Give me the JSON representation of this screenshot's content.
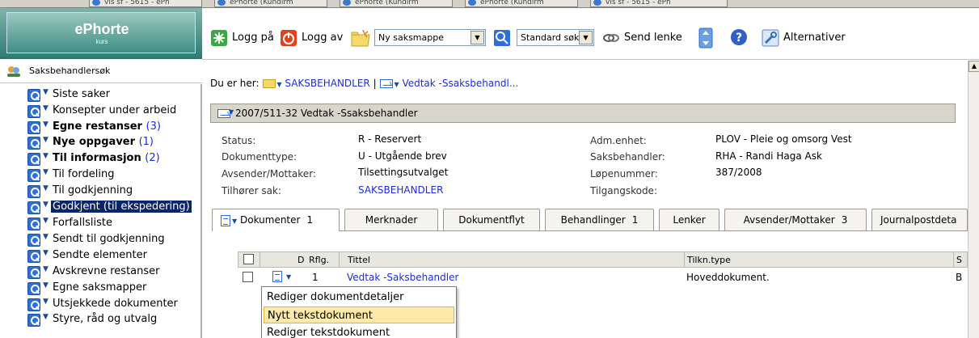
{
  "browser_tabs": [
    {
      "label": "vis sf - 5615 - ePh"
    },
    {
      "label": "ePhorte (Kundirm"
    },
    {
      "label": "ePhorte (Kundirm"
    },
    {
      "label": "ePhorte (Kundirm"
    },
    {
      "label": "vis sf - 5615 - ePh"
    }
  ],
  "logo": {
    "brand": "ePhorte",
    "sub": "kurs"
  },
  "sidebar": {
    "header": "Saksbehandlersøk",
    "items": [
      {
        "label": "Siste saker",
        "count": "",
        "bold": false
      },
      {
        "label": "Konsepter under arbeid",
        "count": "",
        "bold": false
      },
      {
        "label": "Egne restanser",
        "count": "(3)",
        "bold": true
      },
      {
        "label": "Nye oppgaver",
        "count": "(1)",
        "bold": true
      },
      {
        "label": "Til informasjon",
        "count": "(2)",
        "bold": true
      },
      {
        "label": "Til fordeling",
        "count": "",
        "bold": false
      },
      {
        "label": "Til godkjenning",
        "count": "",
        "bold": false
      },
      {
        "label": "Godkjent (til ekspedering)",
        "count": "",
        "bold": false,
        "selected": true
      },
      {
        "label": "Forfallsliste",
        "count": "",
        "bold": false
      },
      {
        "label": "Sendt til godkjenning",
        "count": "",
        "bold": false
      },
      {
        "label": "Sendte elementer",
        "count": "",
        "bold": false
      },
      {
        "label": "Avskrevne restanser",
        "count": "",
        "bold": false
      },
      {
        "label": "Egne saksmapper",
        "count": "",
        "bold": false
      },
      {
        "label": "Utsjekkede dokumenter",
        "count": "",
        "bold": false
      },
      {
        "label": "Styre, råd og utvalg",
        "count": "",
        "bold": false
      }
    ]
  },
  "toolbar": {
    "login": "Logg på",
    "logout": "Logg av",
    "new_select": "Ny saksmappe",
    "search_select": "Standard søk",
    "send_link": "Send lenke",
    "options": "Alternativer"
  },
  "breadcrumb": {
    "prefix": "Du er her:",
    "crumb1": "SAKSBEHANDLER",
    "separator": "|",
    "crumb2": "Vedtak -Ssaksbehandl..."
  },
  "document": {
    "title": "2007/511-32  Vedtak -Ssaksbehandler",
    "left": [
      {
        "key": "Status:",
        "value": "R - Reservert"
      },
      {
        "key": "Dokumenttype:",
        "value": "U - Utgående brev"
      },
      {
        "key": "Avsender/Mottaker:",
        "value": "Tilsettingsutvalget"
      },
      {
        "key": "Tilhører sak:",
        "value": "SAKSBEHANDLER"
      }
    ],
    "right": [
      {
        "key": "Adm.enhet:",
        "value": "PLOV - Pleie og omsorg Vest"
      },
      {
        "key": "Saksbehandler:",
        "value": "RHA - Randi Haga Ask"
      },
      {
        "key": "Løpenummer:",
        "value": "387/2008"
      },
      {
        "key": "Tilgangskode:",
        "value": ""
      }
    ]
  },
  "tabs": [
    {
      "label": "Dokumenter",
      "count": "1"
    },
    {
      "label": "Merknader",
      "count": ""
    },
    {
      "label": "Dokumentflyt",
      "count": ""
    },
    {
      "label": "Behandlinger",
      "count": "1"
    },
    {
      "label": "Lenker",
      "count": ""
    },
    {
      "label": "Avsender/Mottaker",
      "count": "3"
    },
    {
      "label": "Journalpostdeta",
      "count": ""
    }
  ],
  "table": {
    "headers": {
      "d": "D",
      "rflg": "Rflg.",
      "title": "Tittel",
      "type": "Tilkn.type",
      "s": "S"
    },
    "rows": [
      {
        "rflg": "1",
        "title": "Vedtak -Saksbehandler",
        "type": "Hoveddokument.",
        "s": "B"
      }
    ]
  },
  "context_menu": {
    "items": [
      {
        "label": "Rediger dokumentdetaljer"
      },
      {
        "label": "Nytt tekstdokument"
      },
      {
        "label": "Rediger tekstdokument"
      }
    ]
  }
}
